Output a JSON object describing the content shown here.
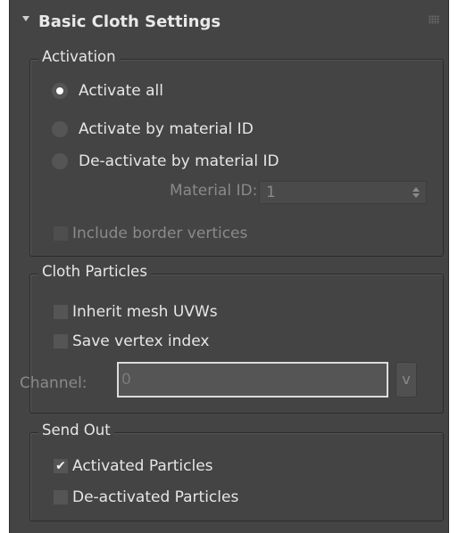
{
  "rollout": {
    "title": "Basic Cloth Settings"
  },
  "activation": {
    "group_title": "Activation",
    "options": [
      {
        "label": "Activate all",
        "checked": true
      },
      {
        "label": "Activate by material ID",
        "checked": false
      },
      {
        "label": "De-activate by material ID",
        "checked": false
      }
    ],
    "material_id": {
      "label": "Material ID:",
      "value": "1",
      "enabled": false
    },
    "include_border": {
      "label": "Include border vertices",
      "checked": false,
      "enabled": false
    }
  },
  "cloth_particles": {
    "group_title": "Cloth Particles",
    "inherit_uvws": {
      "label": "Inherit mesh UVWs",
      "checked": false
    },
    "save_vertex": {
      "label": "Save vertex index",
      "checked": false
    },
    "channel": {
      "label": "Channel:",
      "value": "0",
      "button_label": "v",
      "enabled": false
    }
  },
  "send_out": {
    "group_title": "Send Out",
    "activated": {
      "label": "Activated Particles",
      "checked": true,
      "check_glyph": "✔"
    },
    "deactivated": {
      "label": "De-activated Particles",
      "checked": false
    }
  }
}
